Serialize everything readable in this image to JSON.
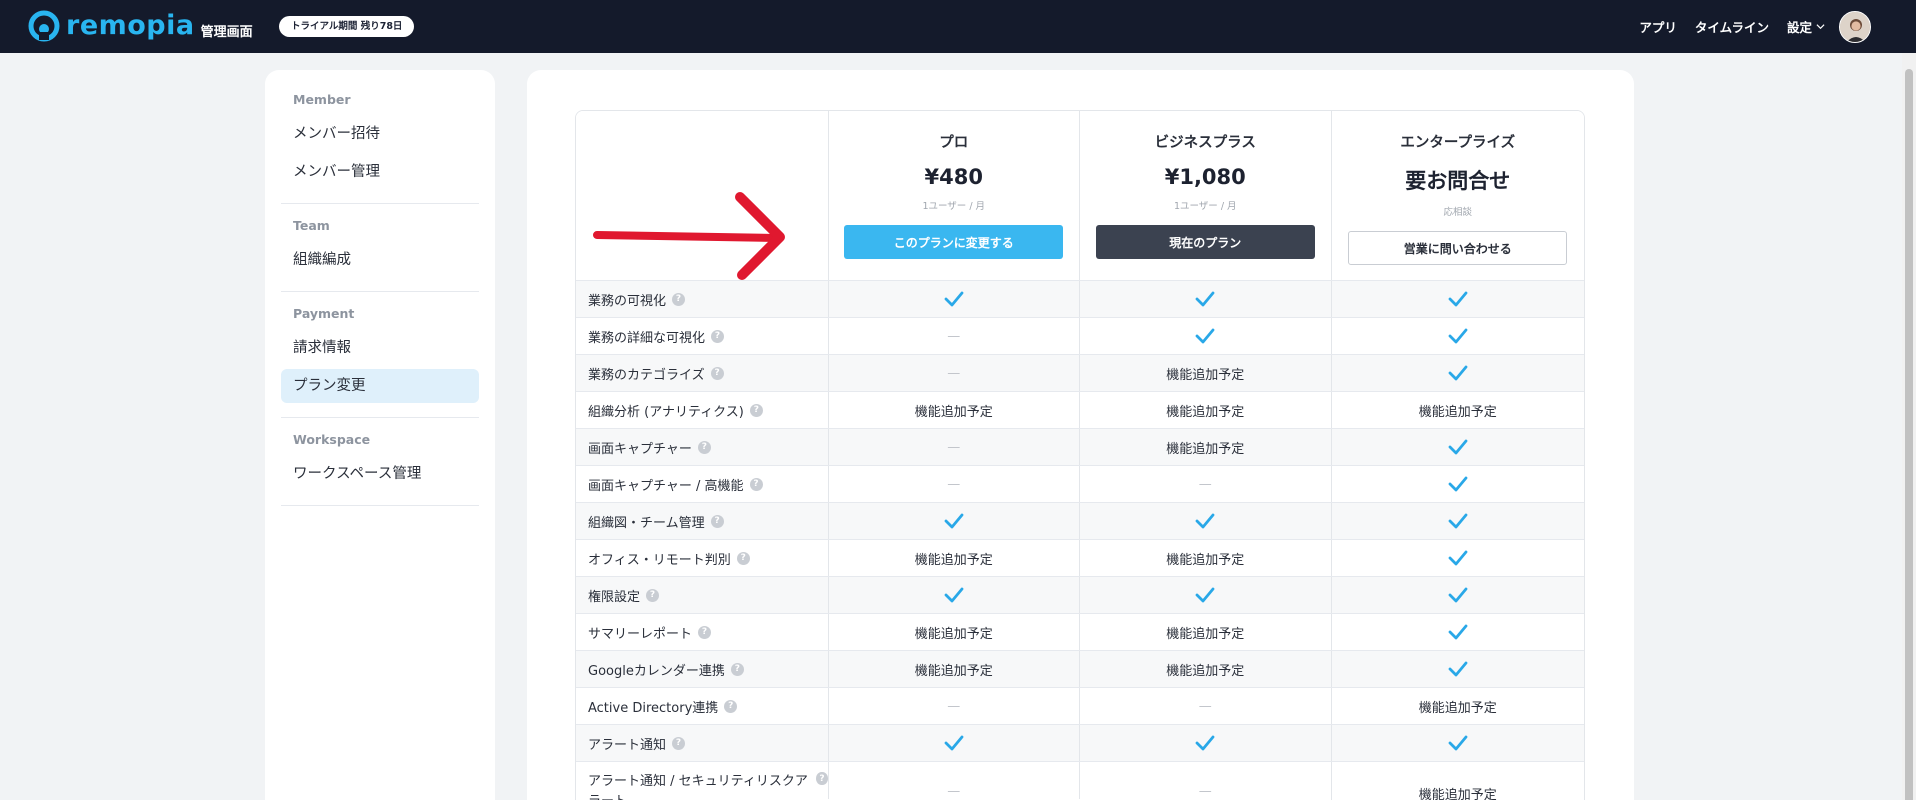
{
  "brand": {
    "name": "remopia",
    "subtitle": "管理画面",
    "trial_badge": "トライアル期間 残り78日",
    "accent_color": "#29b5f0"
  },
  "topnav": {
    "items": [
      {
        "label": "アプリ"
      },
      {
        "label": "タイムライン"
      },
      {
        "label": "設定"
      }
    ]
  },
  "sidebar": {
    "groups": [
      {
        "title": "Member",
        "items": [
          {
            "label": "メンバー招待"
          },
          {
            "label": "メンバー管理"
          }
        ]
      },
      {
        "title": "Team",
        "items": [
          {
            "label": "組織編成"
          }
        ]
      },
      {
        "title": "Payment",
        "items": [
          {
            "label": "請求情報"
          },
          {
            "label": "プラン変更",
            "active": true
          }
        ]
      },
      {
        "title": "Workspace",
        "items": [
          {
            "label": "ワークスペース管理"
          }
        ]
      }
    ]
  },
  "plans": [
    {
      "name": "プロ",
      "price": "¥480",
      "unit": "1ユーザー / 月",
      "button": "このプランに変更する",
      "button_style": "primary"
    },
    {
      "name": "ビジネスプラス",
      "price": "¥1,080",
      "unit": "1ユーザー / 月",
      "button": "現在のプラン",
      "button_style": "current"
    },
    {
      "name": "エンタープライズ",
      "price": "要お問合せ",
      "unit": "応相談",
      "button": "営業に問い合わせる",
      "button_style": "outline"
    }
  ],
  "features": [
    {
      "label": "業務の可視化",
      "values": [
        "check",
        "check",
        "check"
      ]
    },
    {
      "label": "業務の詳細な可視化",
      "values": [
        "dash",
        "check",
        "check"
      ]
    },
    {
      "label": "業務のカテゴライズ",
      "values": [
        "dash",
        "機能追加予定",
        "check"
      ]
    },
    {
      "label": "組織分析 (アナリティクス)",
      "values": [
        "機能追加予定",
        "機能追加予定",
        "機能追加予定"
      ]
    },
    {
      "label": "画面キャプチャー",
      "values": [
        "dash",
        "機能追加予定",
        "check"
      ]
    },
    {
      "label": "画面キャプチャー / 高機能",
      "values": [
        "dash",
        "dash",
        "check"
      ]
    },
    {
      "label": "組織図・チーム管理",
      "values": [
        "check",
        "check",
        "check"
      ]
    },
    {
      "label": "オフィス・リモート判別",
      "values": [
        "機能追加予定",
        "機能追加予定",
        "check"
      ]
    },
    {
      "label": "権限設定",
      "values": [
        "check",
        "check",
        "check"
      ]
    },
    {
      "label": "サマリーレポート",
      "values": [
        "機能追加予定",
        "機能追加予定",
        "check"
      ]
    },
    {
      "label": "Googleカレンダー連携",
      "values": [
        "機能追加予定",
        "機能追加予定",
        "check"
      ]
    },
    {
      "label": "Active Directory連携",
      "values": [
        "dash",
        "dash",
        "機能追加予定"
      ]
    },
    {
      "label": "アラート通知",
      "values": [
        "check",
        "check",
        "check"
      ]
    },
    {
      "label": "アラート通知 / セキュリティリスクアラート",
      "values": [
        "dash",
        "dash",
        "機能追加予定"
      ]
    }
  ],
  "symbols": {
    "dash": "—",
    "help": "?"
  },
  "colors": {
    "check": "#29a8e8",
    "annotation_arrow": "#e0182f"
  }
}
